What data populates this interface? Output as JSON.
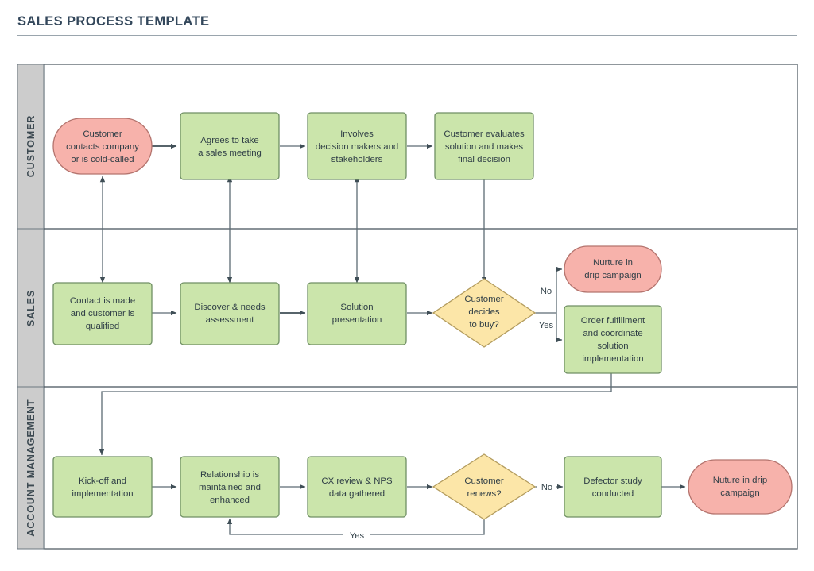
{
  "page": {
    "title": "SALES PROCESS TEMPLATE"
  },
  "colors": {
    "green_fill": "#cbe5ab",
    "green_stroke": "#6f8f63",
    "pink_fill": "#f7b2ab",
    "pink_stroke": "#b4746e",
    "yellow_fill": "#fce6a8",
    "yellow_stroke": "#b39c5e",
    "lane_band": "#cccccc",
    "lane_border": "#45525a",
    "connector": "#5c6b73",
    "title_text": "#33475b",
    "node_text": "#2f3e46"
  },
  "lanes": [
    {
      "id": "customer",
      "label": "CUSTOMER"
    },
    {
      "id": "sales",
      "label": "SALES"
    },
    {
      "id": "account_management",
      "label": "ACCOUNT MANAGEMENT"
    }
  ],
  "nodes": {
    "customer_contacts": {
      "lane": "customer",
      "shape": "rounded-terminator",
      "fill": "pink",
      "lines": [
        "Customer",
        "contacts company",
        "or is cold-called"
      ]
    },
    "agrees_meeting": {
      "lane": "customer",
      "shape": "process",
      "fill": "green",
      "lines": [
        "Agrees to take",
        "a sales meeting"
      ]
    },
    "involves_stakeholders": {
      "lane": "customer",
      "shape": "process",
      "fill": "green",
      "lines": [
        "Involves",
        "decision makers and",
        "stakeholders"
      ]
    },
    "customer_evaluates": {
      "lane": "customer",
      "shape": "process",
      "fill": "green",
      "lines": [
        "Customer evaluates",
        "solution and makes",
        "final decision"
      ]
    },
    "contact_made": {
      "lane": "sales",
      "shape": "process",
      "fill": "green",
      "lines": [
        "Contact is made",
        "and customer is",
        "qualified"
      ]
    },
    "discover_needs": {
      "lane": "sales",
      "shape": "process",
      "fill": "green",
      "lines": [
        "Discover & needs",
        "assessment"
      ]
    },
    "solution_presentation": {
      "lane": "sales",
      "shape": "process",
      "fill": "green",
      "lines": [
        "Solution",
        "presentation"
      ]
    },
    "decides_to_buy": {
      "lane": "sales",
      "shape": "decision",
      "fill": "yellow",
      "lines": [
        "Customer",
        "decides",
        "to buy?"
      ]
    },
    "nurture_drip_sales": {
      "lane": "sales",
      "shape": "rounded-terminator",
      "fill": "pink",
      "lines": [
        "Nurture in",
        "drip campaign"
      ]
    },
    "order_fulfillment": {
      "lane": "sales",
      "shape": "process",
      "fill": "green",
      "lines": [
        "Order fulfillment",
        "and coordinate",
        "solution",
        "implementation"
      ]
    },
    "kickoff": {
      "lane": "account_management",
      "shape": "process",
      "fill": "green",
      "lines": [
        "Kick-off and",
        "implementation"
      ]
    },
    "relationship": {
      "lane": "account_management",
      "shape": "process",
      "fill": "green",
      "lines": [
        "Relationship is",
        "maintained and",
        "enhanced"
      ]
    },
    "cx_review": {
      "lane": "account_management",
      "shape": "process",
      "fill": "green",
      "lines": [
        "CX review & NPS",
        "data gathered"
      ]
    },
    "customer_renews": {
      "lane": "account_management",
      "shape": "decision",
      "fill": "yellow",
      "lines": [
        "Customer",
        "renews?"
      ]
    },
    "defector_study": {
      "lane": "account_management",
      "shape": "process",
      "fill": "green",
      "lines": [
        "Defector study",
        "conducted"
      ]
    },
    "nuture_drip_am": {
      "lane": "account_management",
      "shape": "rounded-terminator",
      "fill": "pink",
      "lines": [
        "Nuture in drip",
        "campaign"
      ]
    }
  },
  "edge_labels": {
    "decides_no": "No",
    "decides_yes": "Yes",
    "renews_no": "No",
    "renews_yes": "Yes"
  }
}
